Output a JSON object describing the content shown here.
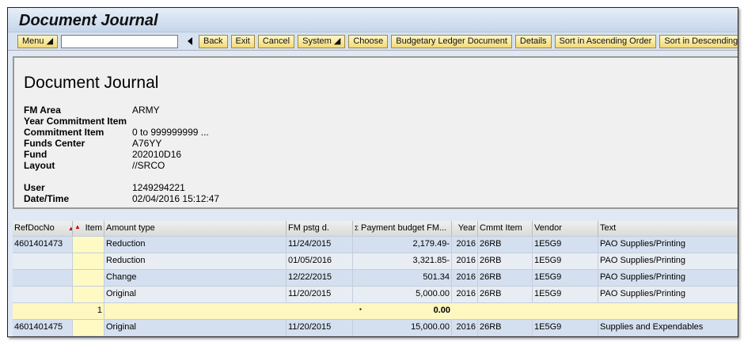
{
  "window": {
    "title": "Document Journal"
  },
  "toolbar": {
    "menu": "Menu ◢",
    "back": "Back",
    "exit": "Exit",
    "cancel": "Cancel",
    "system": "System ◢",
    "choose": "Choose",
    "budgetary": "Budgetary Ledger Document",
    "details": "Details",
    "sort_asc": "Sort in Ascending Order",
    "sort_desc": "Sort in Descending"
  },
  "header": {
    "title": "Document Journal",
    "fields": [
      {
        "label": "FM Area",
        "value": "ARMY"
      },
      {
        "label": "Year Commitment Item",
        "value": ""
      },
      {
        "label": "Commitment Item",
        "value": "0 to 999999999 ..."
      },
      {
        "label": "Funds Center",
        "value": "A76YY"
      },
      {
        "label": "Fund",
        "value": "202010D16"
      },
      {
        "label": "Layout",
        "value": "//SRCO"
      },
      {
        "label": "",
        "value": ""
      },
      {
        "label": "User",
        "value": "1249294221"
      },
      {
        "label": "Date/Time",
        "value": "02/04/2016 15:12:47"
      }
    ]
  },
  "table": {
    "columns": [
      "RefDocNo",
      "Item",
      "Amount type",
      "FM pstg d.",
      "Payment budget FM...",
      "Year",
      "Cmmt Item",
      "Vendor",
      "Text"
    ],
    "sort_icon": "▲",
    "sum_icon": "Σ",
    "rows": [
      {
        "ref": "4601401473",
        "item": "",
        "type": "Reduction",
        "date": "11/24/2015",
        "amount": "2,179.49-",
        "year": "2016",
        "cmmt": "26RB",
        "vendor": "1E5G9",
        "text": "PAO Supplies/Printing"
      },
      {
        "ref": "",
        "item": "",
        "type": "Reduction",
        "date": "01/05/2016",
        "amount": "3,321.85-",
        "year": "2016",
        "cmmt": "26RB",
        "vendor": "1E5G9",
        "text": "PAO Supplies/Printing"
      },
      {
        "ref": "",
        "item": "",
        "type": "Change",
        "date": "12/22/2015",
        "amount": "501.34",
        "year": "2016",
        "cmmt": "26RB",
        "vendor": "1E5G9",
        "text": "PAO Supplies/Printing"
      },
      {
        "ref": "",
        "item": "",
        "type": "Original",
        "date": "11/20/2015",
        "amount": "5,000.00",
        "year": "2016",
        "cmmt": "26RB",
        "vendor": "1E5G9",
        "text": "PAO Supplies/Printing"
      }
    ],
    "subtotal": {
      "item": "1",
      "marker": "▪",
      "amount": "0.00"
    },
    "last_row": {
      "ref": "4601401475",
      "item": "",
      "type": "Original",
      "date": "11/20/2015",
      "amount": "15,000.00",
      "year": "2016",
      "cmmt": "26RB",
      "vendor": "1E5G9",
      "text": "Supplies and Expendables"
    }
  }
}
